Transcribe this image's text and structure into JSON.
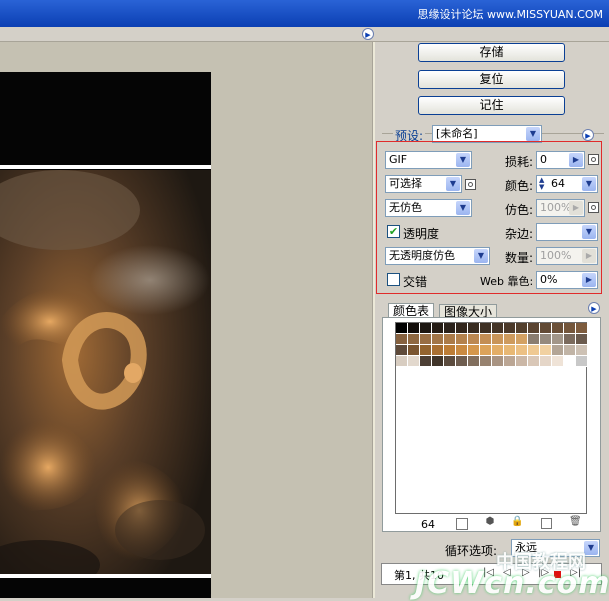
{
  "watermark_top": "思缘设计论坛 www.MISSYUAN.COM",
  "buttons": {
    "save": "存储",
    "reset": "复位",
    "remember": "记住"
  },
  "preset": {
    "label": "预设:",
    "value": "[未命名]"
  },
  "settings": {
    "format": "GIF",
    "reduction": "可选择",
    "dither": "无仿色",
    "transparency_label": "透明度",
    "transparency_checked": true,
    "transparency_dither": "无透明度仿色",
    "interlaced_label": "交错",
    "interlaced_checked": false,
    "lossy_label": "损耗:",
    "lossy_value": "0",
    "colors_label": "颜色:",
    "colors_value": "64",
    "dither_label": "仿色:",
    "dither_amount": "100%",
    "matte_label": "杂边:",
    "matte_value": "",
    "amount_label": "数量:",
    "amount_value": "100%",
    "websnap_label": "Web 靠色:",
    "websnap_value": "0%"
  },
  "tabs": {
    "color_table": "颜色表",
    "image_size": "图像大小"
  },
  "color_table": {
    "count": "64",
    "swatches": [
      "#000000",
      "#120d0a",
      "#1c1611",
      "#251c15",
      "#2b221b",
      "#32261c",
      "#382b20",
      "#3e3024",
      "#443427",
      "#4b392a",
      "#523f2d",
      "#5a4431",
      "#624a35",
      "#6b5038",
      "#74563b",
      "#7e5c3e",
      "#86613f",
      "#8f6841",
      "#986e44",
      "#a27547",
      "#ab7b49",
      "#b4824d",
      "#bc8851",
      "#c38e55",
      "#c99559",
      "#ce9b5e",
      "#d3a163",
      "#8a7d70",
      "#958a7e",
      "#a29689",
      "#7a6a5d",
      "#6a5a4d",
      "#5e4a3a",
      "#7a5530",
      "#93642f",
      "#a96f31",
      "#bd7d36",
      "#c98a41",
      "#d4974c",
      "#dca35a",
      "#e3ae67",
      "#e8b874",
      "#ecc083",
      "#efc992",
      "#f1d1a1",
      "#b3a596",
      "#c1b4a6",
      "#cdc1b4",
      "#d8cdc1",
      "#e2d8cd",
      "#4d4035",
      "#403429",
      "#5b4b3e",
      "#6e5d4f",
      "#826f5e",
      "#97826f",
      "#a99482",
      "#bba694",
      "#cbb7a6",
      "#d9c7b7",
      "#e5d6c8",
      "#efe3d7",
      "#ffffff",
      "#c8c8c8"
    ]
  },
  "loop": {
    "label": "循环选项:",
    "value": "永远"
  },
  "frame": {
    "label": "第1, 共10"
  },
  "watermark_bottom": "中国教程网",
  "watermark_site": "JCWcn.com"
}
